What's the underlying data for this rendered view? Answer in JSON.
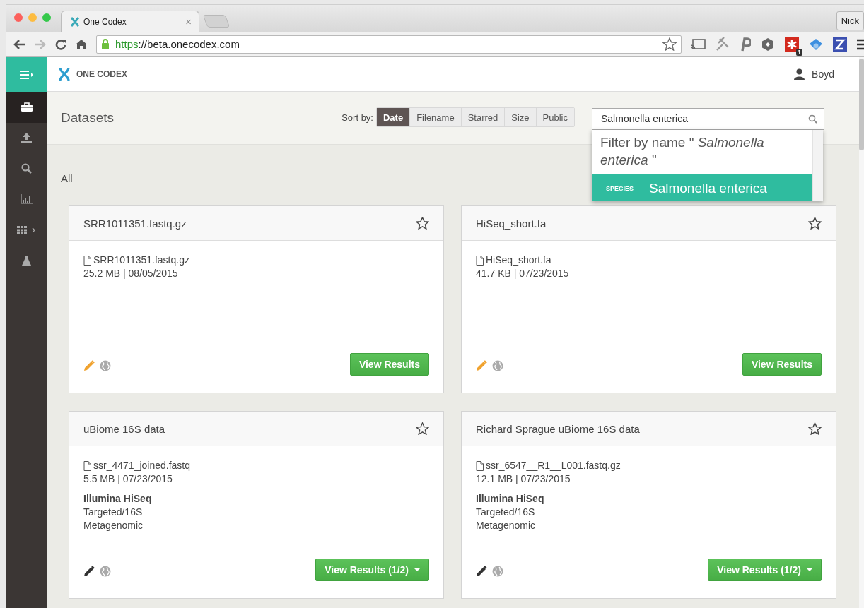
{
  "browser": {
    "tab_title": "One Codex",
    "tab_close": "×",
    "profile": "Nick",
    "url_scheme": "https",
    "url_rest": "://beta.onecodex.com",
    "extension_badge": "1"
  },
  "sidebar": {
    "items": [
      {
        "kind": "menu",
        "selected": false
      },
      {
        "kind": "datasets",
        "selected": true
      },
      {
        "kind": "upload",
        "selected": false
      },
      {
        "kind": "search",
        "selected": false
      },
      {
        "kind": "chart",
        "selected": false
      },
      {
        "kind": "apps",
        "selected": false
      },
      {
        "kind": "lab",
        "selected": false
      }
    ]
  },
  "header": {
    "brand": "ONE CODEX",
    "user": "Boyd"
  },
  "page_title": "Datasets",
  "sort": {
    "label": "Sort by:",
    "options": [
      {
        "label": "Date",
        "selected": true
      },
      {
        "label": "Filename",
        "selected": false
      },
      {
        "label": "Starred",
        "selected": false
      },
      {
        "label": "Size",
        "selected": false
      },
      {
        "label": "Public",
        "selected": false
      }
    ]
  },
  "search": {
    "value": "Salmonella enterica",
    "suggestions": [
      {
        "kind": "filter",
        "text": "Filter by name \" *Salmonella enterica* \"",
        "selected": false
      },
      {
        "kind": "species",
        "tag": "SPECIES",
        "text": "Salmonella enterica",
        "selected": true
      }
    ]
  },
  "section_title": "All",
  "cards": [
    {
      "title": "SRR1011351.fastq.gz",
      "starred": false,
      "file": "SRR1011351.fastq.gz",
      "meta": "25.2 MB | 08/05/2015",
      "button": "View Results",
      "has_menu": false,
      "color": "#f0a22e"
    },
    {
      "title": "HiSeq_short.fa",
      "starred": false,
      "file": "HiSeq_short.fa",
      "meta": "41.7 KB | 07/23/2015",
      "button": "View Results",
      "has_menu": false,
      "color": "#f0a22e"
    },
    {
      "title": "uBiome 16S data",
      "starred": false,
      "file": "ssr_4471_joined.fastq",
      "meta": "5.5 MB | 07/23/2015",
      "platform": "Illumina HiSeq",
      "details": [
        "Targeted/16S",
        "Metagenomic"
      ],
      "button": "View Results (1/2)",
      "has_menu": true,
      "color": "#333333"
    },
    {
      "title": "Richard Sprague uBiome 16S data",
      "starred": false,
      "file": "ssr_6547__R1__L001.fastq.gz",
      "meta": "12.1 MB | 07/23/2015",
      "platform": "Illumina HiSeq",
      "details": [
        "Targeted/16S",
        "Metagenomic"
      ],
      "button": "View Results (1/2)",
      "has_menu": true,
      "color": "#333333"
    }
  ]
}
